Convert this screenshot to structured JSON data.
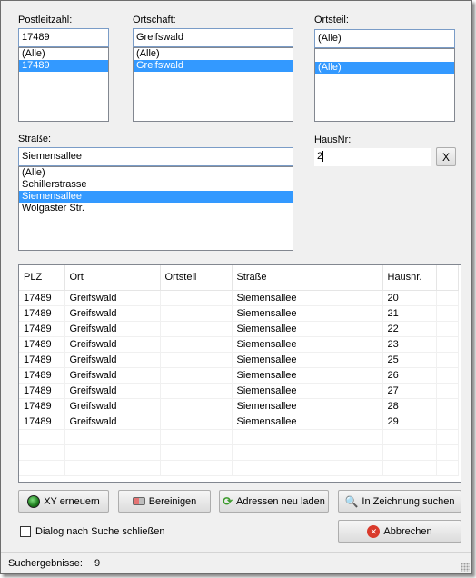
{
  "filters": {
    "plz": {
      "label": "Postleitzahl:",
      "value": "17489",
      "items": [
        "(Alle)",
        "17489"
      ],
      "selected_index": 1
    },
    "ort": {
      "label": "Ortschaft:",
      "value": "Greifswald",
      "items": [
        "(Alle)",
        "Greifswald"
      ],
      "selected_index": 1
    },
    "ortsteil": {
      "label": "Ortsteil:",
      "value": "(Alle)",
      "items": [
        "",
        "(Alle)"
      ],
      "selected_index": 1
    },
    "strasse": {
      "label": "Straße:",
      "value": "Siemensallee",
      "items": [
        "(Alle)",
        "Schillerstrasse",
        "Siemensallee",
        "Wolgaster Str."
      ],
      "selected_index": 2
    },
    "hausnr": {
      "label": "HausNr:",
      "value": "2",
      "clear_label": "X"
    }
  },
  "results": {
    "columns": [
      "PLZ",
      "Ort",
      "Ortsteil",
      "Straße",
      "Hausnr."
    ],
    "rows": [
      [
        "17489",
        "Greifswald",
        "",
        "Siemensallee",
        "20"
      ],
      [
        "17489",
        "Greifswald",
        "",
        "Siemensallee",
        "21"
      ],
      [
        "17489",
        "Greifswald",
        "",
        "Siemensallee",
        "22"
      ],
      [
        "17489",
        "Greifswald",
        "",
        "Siemensallee",
        "23"
      ],
      [
        "17489",
        "Greifswald",
        "",
        "Siemensallee",
        "25"
      ],
      [
        "17489",
        "Greifswald",
        "",
        "Siemensallee",
        "26"
      ],
      [
        "17489",
        "Greifswald",
        "",
        "Siemensallee",
        "27"
      ],
      [
        "17489",
        "Greifswald",
        "",
        "Siemensallee",
        "28"
      ],
      [
        "17489",
        "Greifswald",
        "",
        "Siemensallee",
        "29"
      ]
    ],
    "empty_rows": 3
  },
  "buttons": {
    "xy": {
      "label": "XY erneuern",
      "icon": "green-dot-icon"
    },
    "clean": {
      "label": "Bereinigen",
      "icon": "eraser-icon"
    },
    "reload": {
      "label": "Adressen neu laden",
      "icon": "refresh-icon"
    },
    "search": {
      "label": "In Zeichnung suchen",
      "icon": "magnifier-icon"
    },
    "cancel": {
      "label": "Abbrechen",
      "icon": "cancel-icon"
    }
  },
  "checkbox": {
    "label": "Dialog nach Suche schließen",
    "checked": false
  },
  "status": {
    "label": "Suchergebnisse:",
    "count": "9"
  },
  "colors": {
    "selection": "#3399ff",
    "field_border": "#7a9cc7",
    "cancel_red": "#d93a2b"
  }
}
